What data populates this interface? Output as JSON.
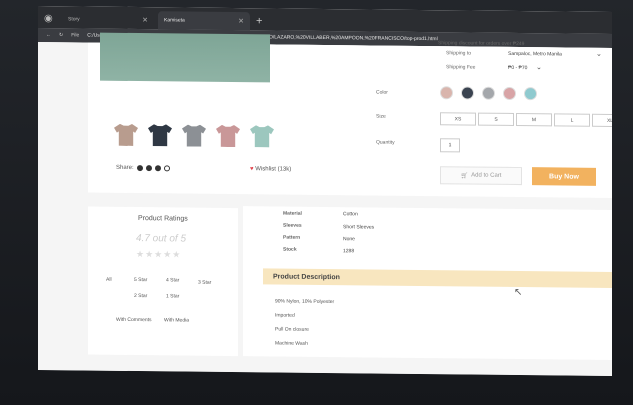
{
  "browser": {
    "tabs": [
      {
        "title": "Story",
        "active": false
      },
      {
        "title": "Kamiseta",
        "active": true
      }
    ],
    "new_tab": "+",
    "address_prefix": "File",
    "url": "C:/Users/63917/Desktop/LAZARO,%20VILLABER,%20AMPOON,%20FRANCISCO/LAZARO,%20VILLABER,%20AMPOON,%20FRANCISCO/top-prod1.html"
  },
  "product": {
    "shipping_discount": "Shipping discount for orders over ₱249",
    "shipping_to_label": "Shipping to",
    "shipping_to_value": "Sampaloc, Metro Manila",
    "shipping_fee_label": "Shipping Fee",
    "shipping_fee_value": "₱0 - ₱70",
    "color_label": "Color",
    "colors": [
      "#d9b5ad",
      "#3a4350",
      "#a4a7ab",
      "#d8a4a6",
      "#8fcacf"
    ],
    "thumb_colors": [
      "#b89c8e",
      "#2f3844",
      "#8c9095",
      "#c99798",
      "#9cc7be"
    ],
    "size_label": "Size",
    "sizes": [
      "XS",
      "S",
      "M",
      "L",
      "XL"
    ],
    "quantity_label": "Quantity",
    "quantity_value": "1",
    "share_label": "Share:",
    "wishlist_label": "Wishlist (13k)",
    "add_to_cart": "Add to Cart",
    "buy_now": "Buy Now"
  },
  "ratings": {
    "title": "Product Ratings",
    "score": "4.7 out of 5",
    "stars": "★★★★★",
    "filters": [
      "All",
      "5 Star",
      "4 Star",
      "3 Star",
      "2 Star",
      "1 Star",
      "With Comments",
      "With Media"
    ]
  },
  "details": {
    "specs": [
      {
        "label": "Material",
        "value": "Cotton"
      },
      {
        "label": "Sleeves",
        "value": "Short Sleeves"
      },
      {
        "label": "Pattern",
        "value": "None"
      },
      {
        "label": "Stock",
        "value": "1288"
      }
    ],
    "description_title": "Product Description",
    "description_lines": [
      "90% Nylon, 10% Polyester",
      "Imported",
      "Pull On closure",
      "Machine Wash"
    ]
  }
}
